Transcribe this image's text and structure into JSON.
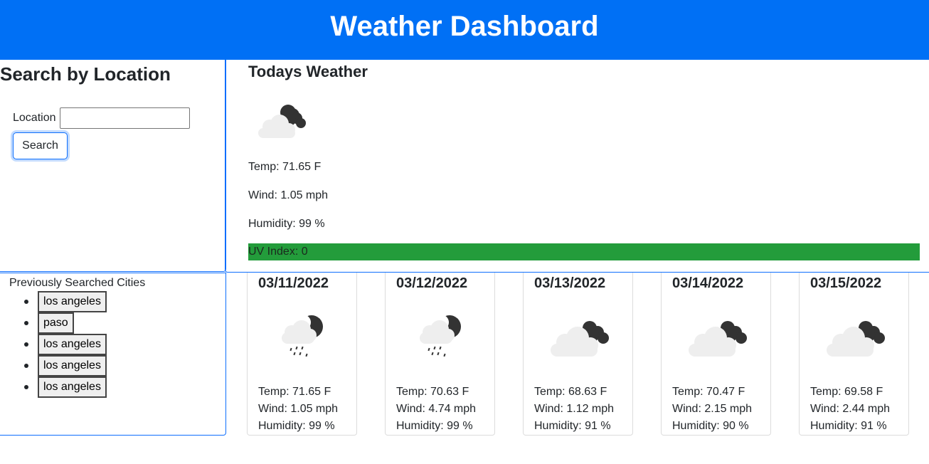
{
  "header": {
    "title": "Weather Dashboard"
  },
  "search": {
    "title": "Search by Location",
    "location_label": "Location",
    "location_value": "",
    "button_label": "Search"
  },
  "today": {
    "title": "Todays Weather",
    "icon": "cloud-moon-icon",
    "temp": "Temp: 71.65 F",
    "wind": "Wind: 1.05 mph",
    "humidity": "Humidity: 99 %",
    "uv": "UV Index: 0",
    "uv_color": "#239c3b"
  },
  "history": {
    "title": "Previously Searched Cities",
    "items": [
      "los angeles",
      "paso",
      "los angeles",
      "los angeles",
      "los angeles"
    ]
  },
  "forecast": [
    {
      "date": "03/11/2022",
      "icon": "rain-cloud-moon-icon",
      "temp": "Temp: 71.65 F",
      "wind": "Wind: 1.05 mph",
      "humidity": "Humidity: 99 %"
    },
    {
      "date": "03/12/2022",
      "icon": "rain-cloud-moon-icon",
      "temp": "Temp: 70.63 F",
      "wind": "Wind: 4.74 mph",
      "humidity": "Humidity: 99 %"
    },
    {
      "date": "03/13/2022",
      "icon": "cloud-moon-icon",
      "temp": "Temp: 68.63 F",
      "wind": "Wind: 1.12 mph",
      "humidity": "Humidity: 91 %"
    },
    {
      "date": "03/14/2022",
      "icon": "cloud-moon-icon",
      "temp": "Temp: 70.47 F",
      "wind": "Wind: 2.15 mph",
      "humidity": "Humidity: 90 %"
    },
    {
      "date": "03/15/2022",
      "icon": "cloud-moon-icon",
      "temp": "Temp: 69.58 F",
      "wind": "Wind: 2.44 mph",
      "humidity": "Humidity: 91 %"
    }
  ],
  "colors": {
    "header": "#0070f5",
    "accent": "#0d6efd"
  }
}
